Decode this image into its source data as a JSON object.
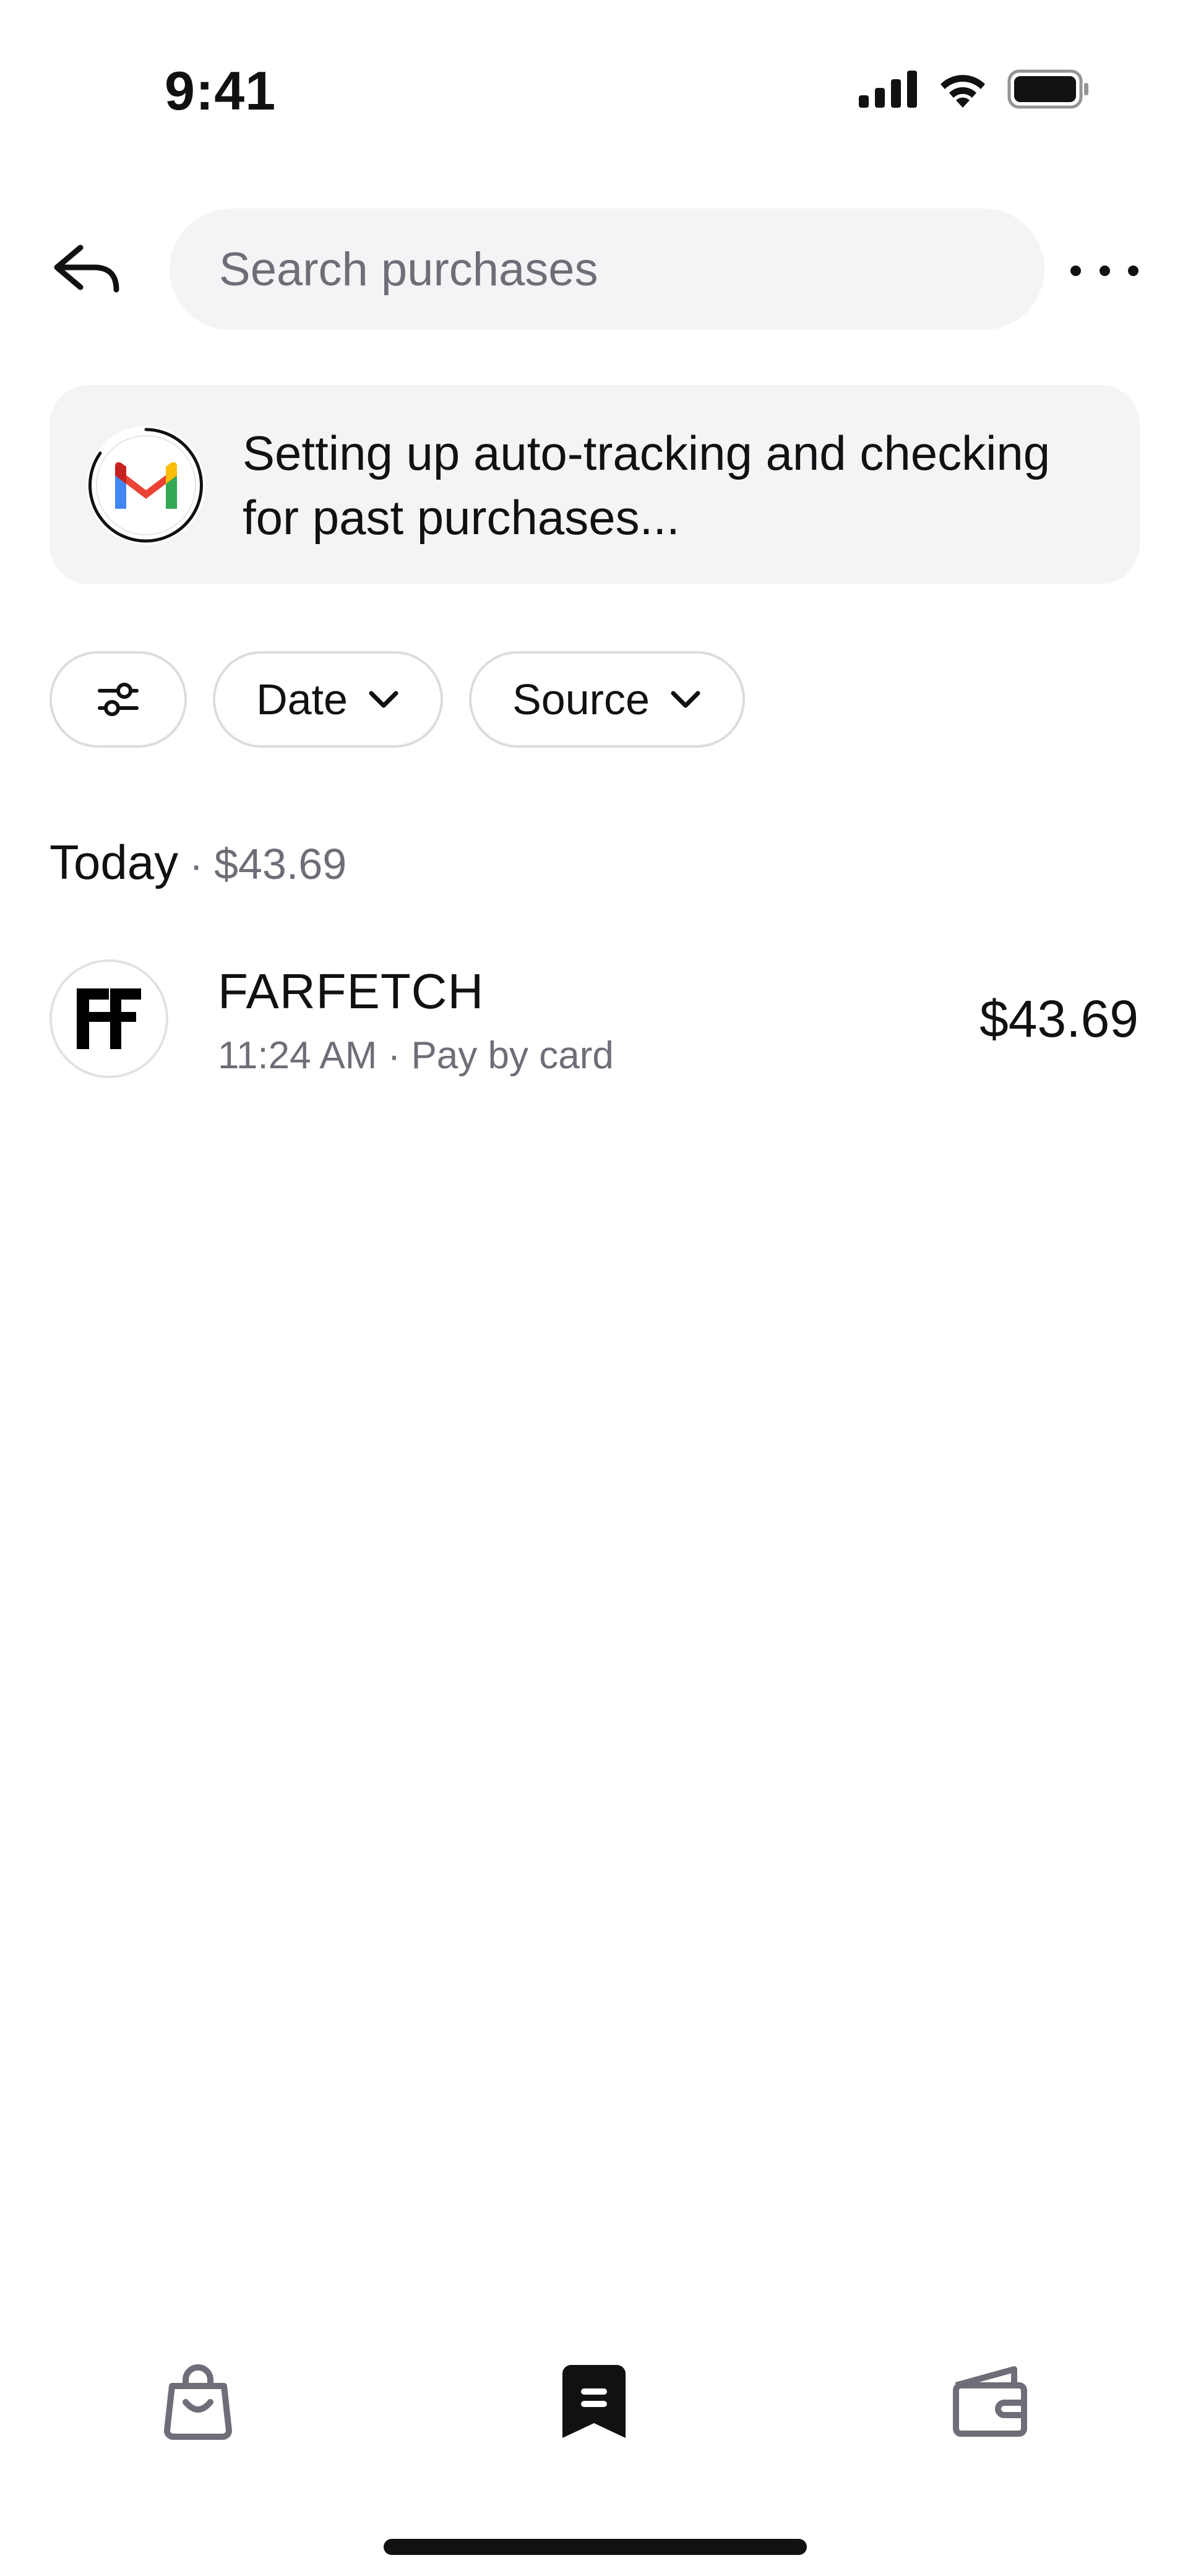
{
  "status_bar": {
    "time": "9:41"
  },
  "search": {
    "placeholder": "Search purchases"
  },
  "banner": {
    "text": "Setting up auto-tracking and checking for past purchases..."
  },
  "filters": {
    "date_label": "Date",
    "source_label": "Source"
  },
  "section": {
    "title": "Today",
    "separator": "·",
    "total": "$43.69"
  },
  "purchases": [
    {
      "merchant": "FARFETCH",
      "meta": "11:24 AM · Pay by card",
      "amount": "$43.69",
      "logo_icon": "farfetch-logo"
    }
  ],
  "bottom_nav": {
    "items": [
      {
        "icon": "shopping-bag-icon",
        "active": false
      },
      {
        "icon": "receipt-icon",
        "active": true
      },
      {
        "icon": "wallet-icon",
        "active": false
      }
    ]
  },
  "colors": {
    "background": "#ffffff",
    "surface": "#f4f4f6",
    "text_primary": "#111114",
    "text_secondary": "#6e6e78",
    "nav_inactive": "#6e6e78",
    "gmail_red": "#EA4335",
    "gmail_blue": "#4285F4",
    "gmail_green": "#34A853",
    "gmail_yellow": "#FBBC05"
  }
}
